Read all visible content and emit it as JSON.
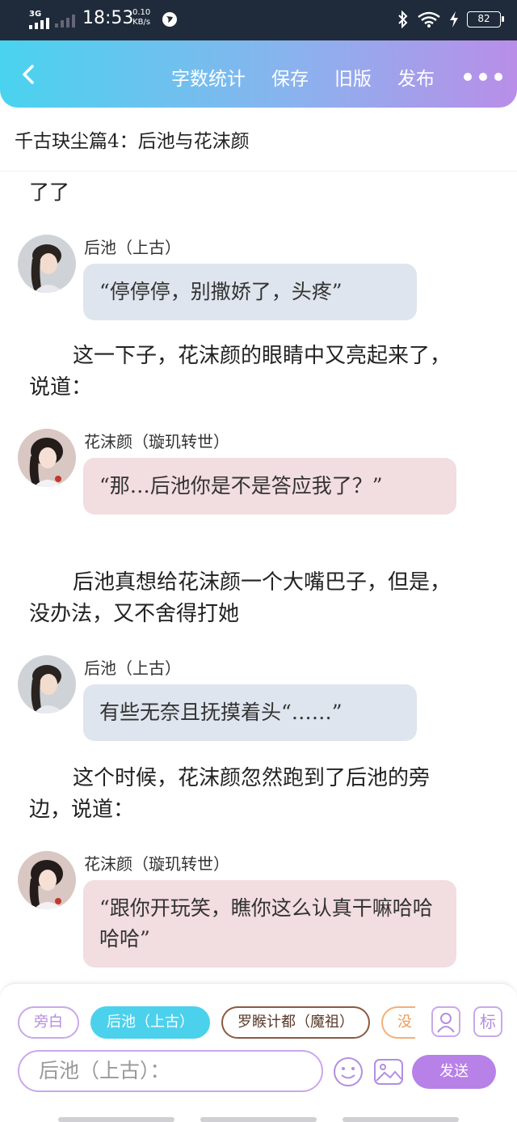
{
  "status_bar": {
    "network": "3G",
    "time": "18:53",
    "speed_value": "0.10",
    "speed_unit": "KB/s",
    "battery": "82"
  },
  "nav": {
    "actions": [
      "字数统计",
      "保存",
      "旧版",
      "发布"
    ]
  },
  "chapter_title": "千古玦尘篇4：后池与花沫颜",
  "content": {
    "cut_off_line": "了了",
    "blocks": [
      {
        "type": "dialogue",
        "speaker": "后池（上古）",
        "text": "“停停停，别撒娇了，头疼”",
        "style": "blue",
        "avatar": "houchi-avatar"
      },
      {
        "type": "narration",
        "text": "这一下子，花沫颜的眼睛中又亮起来了，说道："
      },
      {
        "type": "dialogue",
        "speaker": "花沫颜（璇玑转世）",
        "text": "“那…后池你是不是答应我了？”",
        "style": "pink",
        "avatar": "huamoyan-avatar"
      },
      {
        "type": "narration",
        "text": "后池真想给花沫颜一个大嘴巴子，但是，没办法，又不舍得打她"
      },
      {
        "type": "dialogue",
        "speaker": "后池（上古）",
        "text": "有些无奈且抚摸着头“……”",
        "style": "blue",
        "avatar": "houchi-avatar"
      },
      {
        "type": "narration",
        "text": "这个时候，花沫颜忽然跑到了后池的旁边，说道："
      },
      {
        "type": "dialogue",
        "speaker": "花沫颜（璇玑转世）",
        "text": "“跟你开玩笑，瞧你这么认真干嘛哈哈哈哈”",
        "style": "pink",
        "avatar": "huamoyan-avatar"
      }
    ]
  },
  "input_panel": {
    "roles": [
      "旁白",
      "后池（上古）",
      "罗睺计都（魔祖）",
      "没"
    ],
    "active_role": "后池（上古）",
    "tag_button": "标",
    "input_value": "后池（上古）：",
    "send_label": "发送"
  },
  "colors": {
    "accent_cyan": "#4bd1ec",
    "accent_purple": "#b781e7",
    "bubble_blue": "#dfe5ee",
    "bubble_pink": "#f2dde0"
  }
}
